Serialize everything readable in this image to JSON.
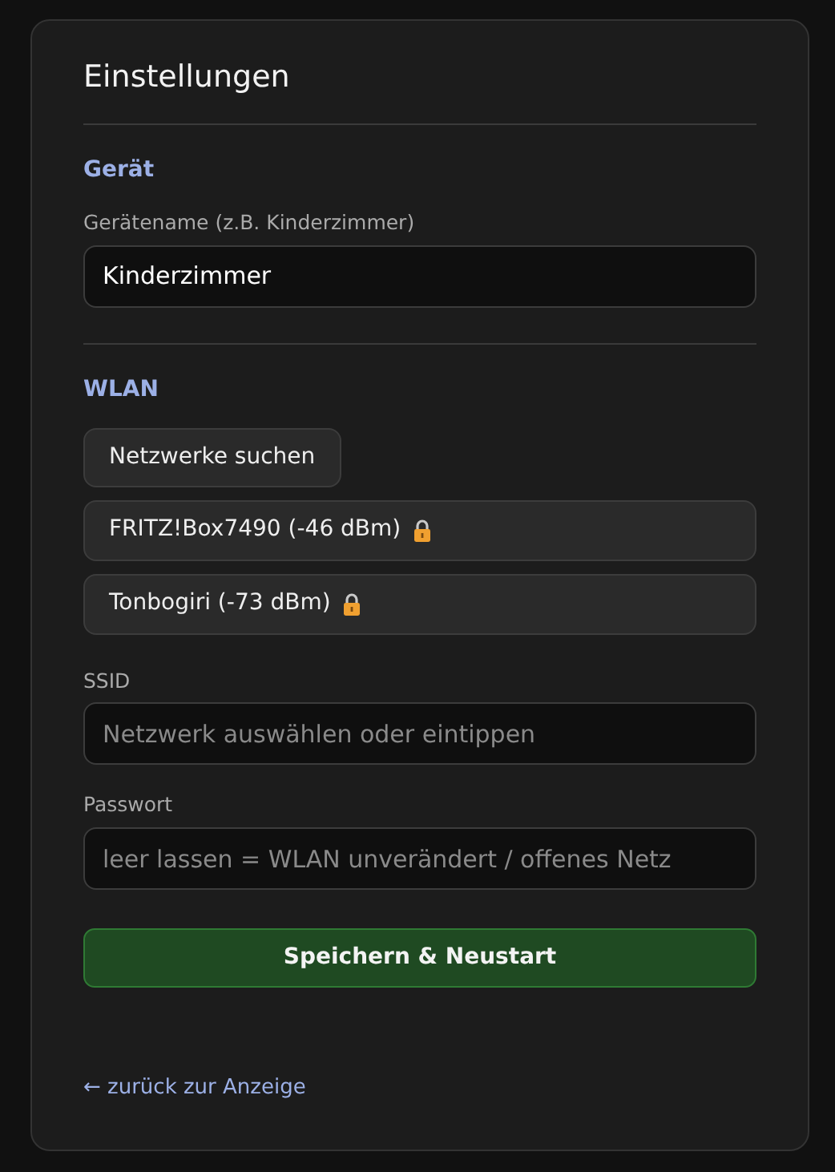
{
  "title": "Einstellungen",
  "sections": [
    {
      "heading": "Gerät",
      "fields": [
        {
          "label": "Gerätename (z.B. Kinderzimmer)",
          "value": "Kinderzimmer"
        }
      ]
    },
    {
      "heading": "WLAN",
      "scan_button": "Netzwerke suchen",
      "networks": [
        {
          "label": "FRITZ!Box7490 (-46 dBm)",
          "secured": true
        },
        {
          "label": "Tonbogiri (-73 dBm)",
          "secured": true
        }
      ],
      "fields": [
        {
          "label": "SSID",
          "placeholder": "Netzwerk auswählen oder eintippen"
        },
        {
          "label": "Passwort",
          "placeholder": "leer lassen = WLAN unverändert / offenes Netz"
        }
      ]
    }
  ],
  "save_button": "Speichern & Neustart",
  "back_link": "← zurück zur Anzeige"
}
